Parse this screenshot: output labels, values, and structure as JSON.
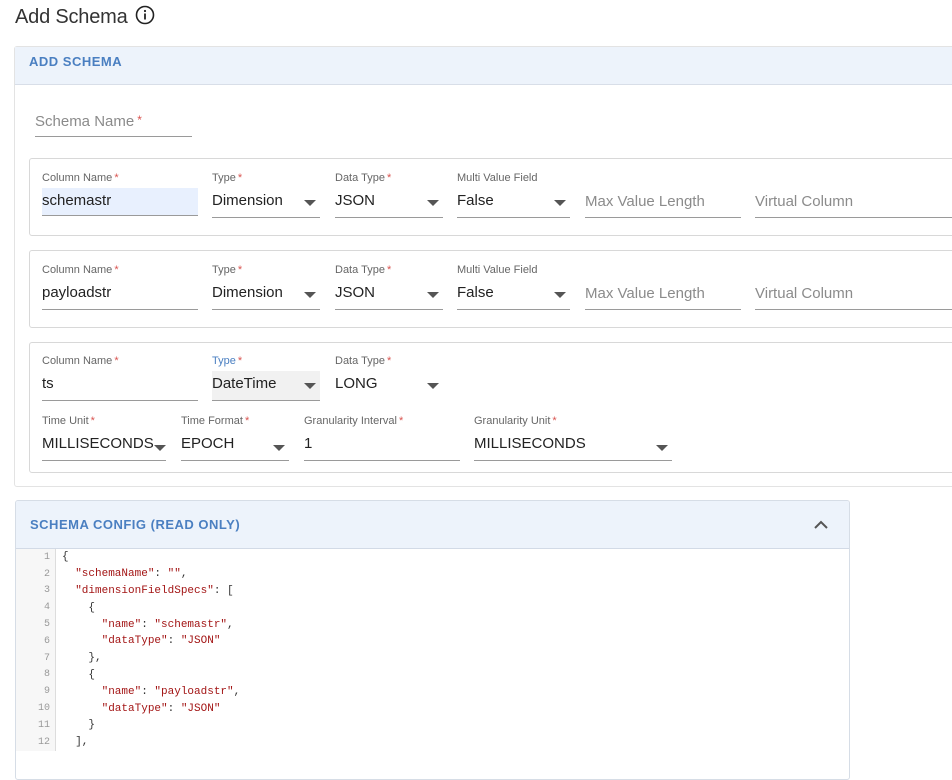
{
  "page": {
    "title": "Add Schema"
  },
  "add_schema": {
    "header": "ADD SCHEMA",
    "schema_name": {
      "label": "Schema Name",
      "value": ""
    }
  },
  "columns": [
    {
      "column_name_label": "Column Name",
      "column_name": "schemastr",
      "type_label": "Type",
      "type": "Dimension",
      "data_type_label": "Data Type",
      "data_type": "JSON",
      "multi_value_label": "Multi Value Field",
      "multi_value": "False",
      "max_value_length_placeholder": "Max Value Length",
      "virtual_column_placeholder": "Virtual Column"
    },
    {
      "column_name_label": "Column Name",
      "column_name": "payloadstr",
      "type_label": "Type",
      "type": "Dimension",
      "data_type_label": "Data Type",
      "data_type": "JSON",
      "multi_value_label": "Multi Value Field",
      "multi_value": "False",
      "max_value_length_placeholder": "Max Value Length",
      "virtual_column_placeholder": "Virtual Column"
    },
    {
      "column_name_label": "Column Name",
      "column_name": "ts",
      "type_label": "Type",
      "type": "DateTime",
      "data_type_label": "Data Type",
      "data_type": "LONG",
      "time_unit_label": "Time Unit",
      "time_unit": "MILLISECONDS",
      "time_format_label": "Time Format",
      "time_format": "EPOCH",
      "granularity_interval_label": "Granularity Interval",
      "granularity_interval": "1",
      "granularity_unit_label": "Granularity Unit",
      "granularity_unit": "MILLISECONDS"
    }
  ],
  "required_marker": "*",
  "config": {
    "header": "SCHEMA CONFIG (READ ONLY)",
    "lines": [
      {
        "n": "1",
        "t": "{"
      },
      {
        "n": "2",
        "t": "  \"schemaName\": \"\","
      },
      {
        "n": "3",
        "t": "  \"dimensionFieldSpecs\": ["
      },
      {
        "n": "4",
        "t": "    {"
      },
      {
        "n": "5",
        "t": "      \"name\": \"schemastr\","
      },
      {
        "n": "6",
        "t": "      \"dataType\": \"JSON\""
      },
      {
        "n": "7",
        "t": "    },"
      },
      {
        "n": "8",
        "t": "    {"
      },
      {
        "n": "9",
        "t": "      \"name\": \"payloadstr\","
      },
      {
        "n": "10",
        "t": "      \"dataType\": \"JSON\""
      },
      {
        "n": "11",
        "t": "    }"
      },
      {
        "n": "12",
        "t": "  ],"
      }
    ]
  },
  "colors": {
    "accent": "#4a7fc1",
    "header_bg": "#edf3fb",
    "required": "#d9534f",
    "string": "#a31515"
  },
  "icons": {
    "info": "info-icon",
    "collapse": "chevron-up-icon",
    "dropdown": "caret-down-icon"
  }
}
